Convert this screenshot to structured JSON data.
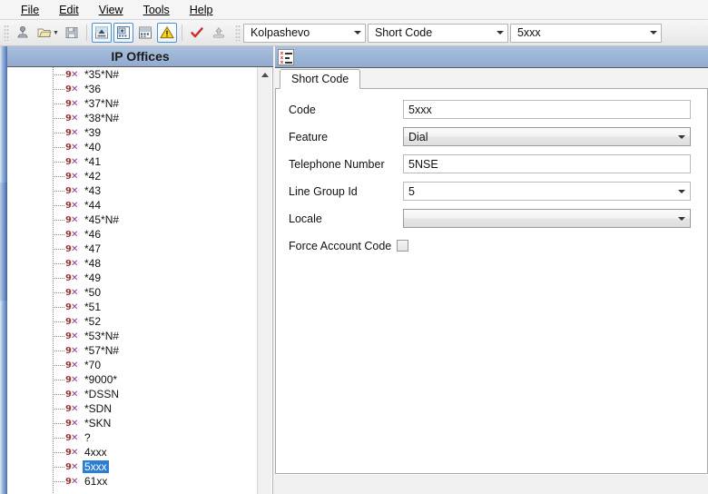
{
  "window": {
    "title": "IP Offices"
  },
  "menubar": {
    "items": [
      {
        "label": "File",
        "mnemonic": "F"
      },
      {
        "label": "Edit",
        "mnemonic": "E"
      },
      {
        "label": "View",
        "mnemonic": "V"
      },
      {
        "label": "Tools",
        "mnemonic": "T"
      },
      {
        "label": "Help",
        "mnemonic": "H"
      }
    ]
  },
  "toolbar": {
    "icons": [
      {
        "name": "connect-icon",
        "glyph": "⚕"
      },
      {
        "name": "open-folder-icon",
        "glyph": "📂"
      },
      {
        "name": "save-icon",
        "glyph": "💾"
      },
      {
        "name": "import-config-icon",
        "glyph": "▲"
      },
      {
        "name": "add-entry-icon",
        "glyph": "⊞"
      },
      {
        "name": "list-view-icon",
        "glyph": "≣"
      },
      {
        "name": "error-warning-icon",
        "glyph": "⚠"
      },
      {
        "name": "validate-icon",
        "glyph": "✔"
      },
      {
        "name": "send-config-icon",
        "glyph": "⤒"
      }
    ],
    "combo_system": {
      "value": "Kolpashevo"
    },
    "combo_type": {
      "value": "Short Code"
    },
    "combo_entry": {
      "value": "5xxx"
    }
  },
  "tree": {
    "header": "IP Offices",
    "selected": "5xxx",
    "items": [
      {
        "label": "*35*N#"
      },
      {
        "label": "*36"
      },
      {
        "label": "*37*N#"
      },
      {
        "label": "*38*N#"
      },
      {
        "label": "*39"
      },
      {
        "label": "*40"
      },
      {
        "label": "*41"
      },
      {
        "label": "*42"
      },
      {
        "label": "*43"
      },
      {
        "label": "*44"
      },
      {
        "label": "*45*N#"
      },
      {
        "label": "*46"
      },
      {
        "label": "*47"
      },
      {
        "label": "*48"
      },
      {
        "label": "*49"
      },
      {
        "label": "*50"
      },
      {
        "label": "*51"
      },
      {
        "label": "*52"
      },
      {
        "label": "*53*N#"
      },
      {
        "label": "*57*N#"
      },
      {
        "label": "*70"
      },
      {
        "label": "*9000*"
      },
      {
        "label": "*DSSN"
      },
      {
        "label": "*SDN"
      },
      {
        "label": "*SKN"
      },
      {
        "label": "?"
      },
      {
        "label": "4xxx"
      },
      {
        "label": "5xxx"
      },
      {
        "label": "61xx"
      }
    ]
  },
  "form": {
    "panel_icon": "short-code-list-icon",
    "tab": "Short Code",
    "fields": {
      "code": {
        "label": "Code",
        "value": "5xxx"
      },
      "feature": {
        "label": "Feature",
        "value": "Dial"
      },
      "telephone_number": {
        "label": "Telephone Number",
        "value": "5NSE"
      },
      "line_group_id": {
        "label": "Line Group Id",
        "value": "5"
      },
      "locale": {
        "label": "Locale",
        "value": ""
      },
      "force_account_code": {
        "label": "Force Account Code",
        "checked": false
      }
    }
  },
  "colors": {
    "header_blue": "#9db5d6",
    "selection_blue": "#2a7fd4",
    "icon_red": "#9e3a35",
    "icon_purple": "#7d3f82"
  }
}
